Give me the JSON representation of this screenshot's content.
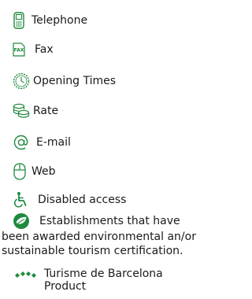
{
  "accent_color": "#1e8a3e",
  "legend": {
    "telephone": {
      "icon": "mobile-phone-icon",
      "label": "Telephone"
    },
    "fax": {
      "icon": "fax-icon",
      "icon_text": "FAX",
      "label": "Fax"
    },
    "opening_times": {
      "icon": "clock-icon",
      "label": "Opening Times"
    },
    "rate": {
      "icon": "coins-icon",
      "label": "Rate"
    },
    "email": {
      "icon": "at-sign-icon",
      "label": "E-mail"
    },
    "web": {
      "icon": "computer-mouse-icon",
      "label": "Web"
    },
    "disabled_access": {
      "icon": "wheelchair-icon",
      "label": "Disabled access"
    },
    "environmental": {
      "icon": "leaf-circle-icon",
      "label_first": "Establishments that have",
      "label_rest_1": "been awarded environmental an/or",
      "label_rest_2": "sustainable tourism certification."
    },
    "product": {
      "icon": "diamonds-icon",
      "label_1": "Turisme de Barcelona",
      "label_2": "Product"
    }
  }
}
